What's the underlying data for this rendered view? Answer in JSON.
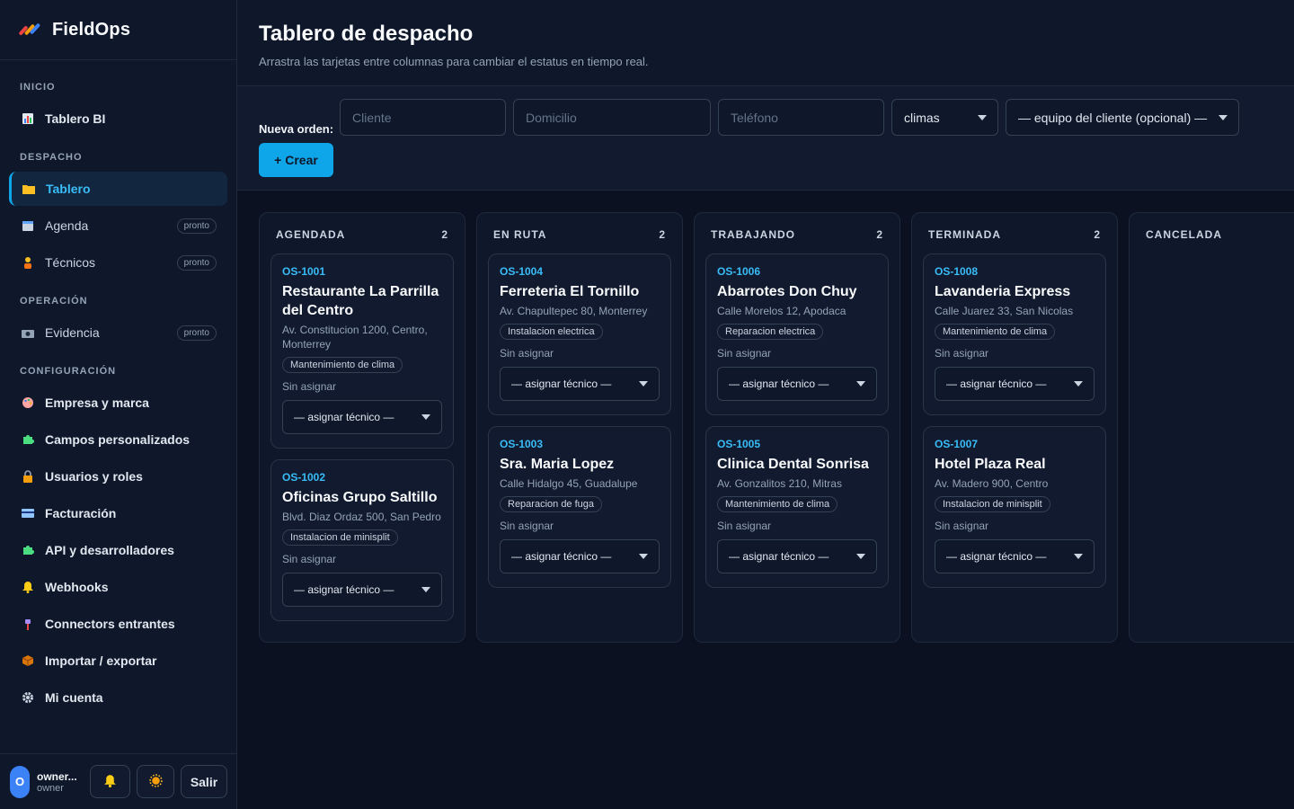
{
  "brand": {
    "name": "FieldOps"
  },
  "sidebar": {
    "sections": [
      {
        "title": "INICIO"
      },
      {
        "title": "DESPACHO"
      },
      {
        "title": "OPERACIÓN"
      },
      {
        "title": "CONFIGURACIÓN"
      }
    ],
    "items": [
      {
        "label": "Tablero BI",
        "icon": "bar-chart-icon"
      },
      {
        "label": "Tablero",
        "icon": "folder-icon",
        "active": true
      },
      {
        "label": "Agenda",
        "icon": "calendar-icon",
        "badge": "pronto"
      },
      {
        "label": "Técnicos",
        "icon": "person-icon",
        "badge": "pronto"
      },
      {
        "label": "Evidencia",
        "icon": "camera-icon",
        "badge": "pronto"
      },
      {
        "label": "Empresa y marca",
        "icon": "palette-icon"
      },
      {
        "label": "Campos personalizados",
        "icon": "puzzle-icon"
      },
      {
        "label": "Usuarios y roles",
        "icon": "lock-icon"
      },
      {
        "label": "Facturación",
        "icon": "card-icon"
      },
      {
        "label": "API y desarrolladores",
        "icon": "puzzle-icon"
      },
      {
        "label": "Webhooks",
        "icon": "bell-icon"
      },
      {
        "label": "Connectors entrantes",
        "icon": "plug-icon"
      },
      {
        "label": "Importar / exportar",
        "icon": "box-icon"
      },
      {
        "label": "Mi cuenta",
        "icon": "gear-icon"
      }
    ]
  },
  "user": {
    "initial": "O",
    "name": "owner...",
    "role": "owner",
    "logout": "Salir"
  },
  "page": {
    "title": "Tablero de despacho",
    "subtitle": "Arrastra las tarjetas entre columnas para cambiar el estatus en tiempo real."
  },
  "new_order": {
    "label": "Nueva orden:",
    "client_placeholder": "Cliente",
    "address_placeholder": "Domicilio",
    "phone_placeholder": "Teléfono",
    "type_value": "climas",
    "equipment_value": "— equipo del cliente (opcional) —",
    "create_label": "+ Crear"
  },
  "columns": [
    {
      "title": "AGENDADA",
      "count": "2",
      "cards": [
        {
          "code": "OS-1001",
          "name": "Restaurante La Parrilla del Centro",
          "address": "Av. Constitucion 1200, Centro, Monterrey",
          "tag": "Mantenimiento de clima",
          "assignee": "Sin asignar",
          "tech": "— asignar técnico —"
        },
        {
          "code": "OS-1002",
          "name": "Oficinas Grupo Saltillo",
          "address": "Blvd. Diaz Ordaz 500, San Pedro",
          "tag": "Instalacion de minisplit",
          "assignee": "Sin asignar",
          "tech": "— asignar técnico —"
        }
      ]
    },
    {
      "title": "EN RUTA",
      "count": "2",
      "cards": [
        {
          "code": "OS-1004",
          "name": "Ferreteria El Tornillo",
          "address": "Av. Chapultepec 80, Monterrey",
          "tag": "Instalacion electrica",
          "assignee": "Sin asignar",
          "tech": "— asignar técnico —"
        },
        {
          "code": "OS-1003",
          "name": "Sra. Maria Lopez",
          "address": "Calle Hidalgo 45, Guadalupe",
          "tag": "Reparacion de fuga",
          "assignee": "Sin asignar",
          "tech": "— asignar técnico —"
        }
      ]
    },
    {
      "title": "TRABAJANDO",
      "count": "2",
      "cards": [
        {
          "code": "OS-1006",
          "name": "Abarrotes Don Chuy",
          "address": "Calle Morelos 12, Apodaca",
          "tag": "Reparacion electrica",
          "assignee": "Sin asignar",
          "tech": "— asignar técnico —"
        },
        {
          "code": "OS-1005",
          "name": "Clinica Dental Sonrisa",
          "address": "Av. Gonzalitos 210, Mitras",
          "tag": "Mantenimiento de clima",
          "assignee": "Sin asignar",
          "tech": "— asignar técnico —"
        }
      ]
    },
    {
      "title": "TERMINADA",
      "count": "2",
      "cards": [
        {
          "code": "OS-1008",
          "name": "Lavanderia Express",
          "address": "Calle Juarez 33, San Nicolas",
          "tag": "Mantenimiento de clima",
          "assignee": "Sin asignar",
          "tech": "— asignar técnico —"
        },
        {
          "code": "OS-1007",
          "name": "Hotel Plaza Real",
          "address": "Av. Madero 900, Centro",
          "tag": "Instalacion de minisplit",
          "assignee": "Sin asignar",
          "tech": "— asignar técnico —"
        }
      ]
    },
    {
      "title": "CANCELADA",
      "count": "",
      "cards": []
    }
  ],
  "colors": {
    "accent": "#0ea5e9",
    "bg": "#0b1120",
    "panel": "#0f172a",
    "card": "#111a2e"
  }
}
